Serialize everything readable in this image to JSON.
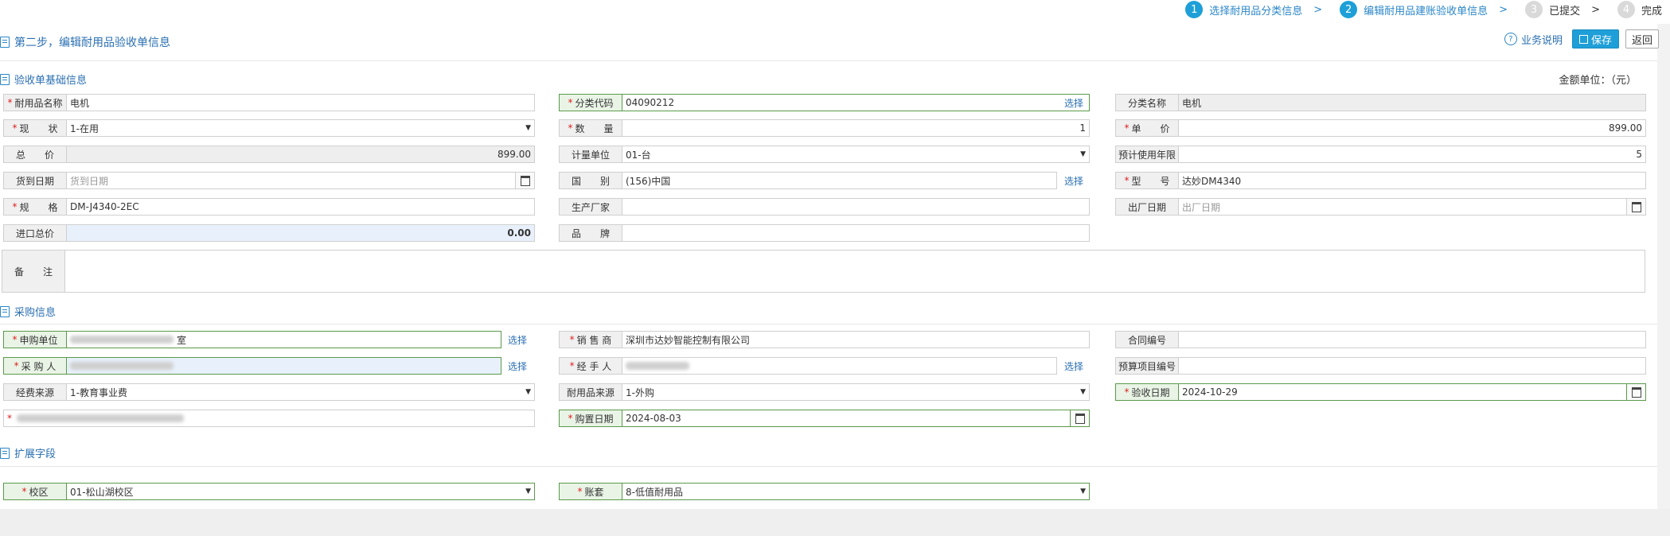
{
  "steps": [
    {
      "num": "1",
      "label": "选择耐用品分类信息",
      "active": true
    },
    {
      "num": "2",
      "label": "编辑耐用品建账验收单信息",
      "active": true
    },
    {
      "num": "3",
      "label": "已提交",
      "active": false
    },
    {
      "num": "4",
      "label": "完成",
      "active": false
    }
  ],
  "step_sep": ">",
  "page_title": "第二步，编辑耐用品验收单信息",
  "actions": {
    "help": "业务说明",
    "save": "保存",
    "back": "返回"
  },
  "sections": {
    "basic": "验收单基础信息",
    "purchase": "采购信息",
    "ext": "扩展字段"
  },
  "amount_unit": "金额单位：（元）",
  "choose_label": "选择",
  "fields": {
    "name": {
      "label": "耐用品名称",
      "value": "电机"
    },
    "code": {
      "label": "分类代码",
      "value": "04090212"
    },
    "cat_name": {
      "label": "分类名称",
      "value": "电机"
    },
    "status": {
      "label": "现　　状",
      "value": "1-在用"
    },
    "qty": {
      "label": "数　　量",
      "value": "1"
    },
    "price": {
      "label": "单　　价",
      "value": "899.00"
    },
    "total": {
      "label": "总　　价",
      "value": "899.00"
    },
    "unit": {
      "label": "计量单位",
      "value": "01-台"
    },
    "years": {
      "label": "预计使用年限",
      "value": "5"
    },
    "arrive": {
      "label": "货到日期",
      "placeholder": "货到日期"
    },
    "country": {
      "label": "国　　别",
      "value": "(156)中国"
    },
    "model": {
      "label": "型　　号",
      "value": "达妙DM4340"
    },
    "spec": {
      "label": "规　　格",
      "value": "DM-J4340-2EC"
    },
    "maker": {
      "label": "生产厂家",
      "value": ""
    },
    "factory_date": {
      "label": "出厂日期",
      "placeholder": "出厂日期"
    },
    "import_total": {
      "label": "进口总价",
      "value": "0.00"
    },
    "brand": {
      "label": "品　　牌",
      "value": ""
    },
    "remark": {
      "label": "备　　注",
      "value": ""
    },
    "dept": {
      "label": "申购单位",
      "value": "室"
    },
    "seller": {
      "label": "销 售 商",
      "value": "深圳市达妙智能控制有限公司"
    },
    "contract": {
      "label": "合同编号",
      "value": ""
    },
    "buyer": {
      "label": "采 购 人",
      "value": ""
    },
    "handler": {
      "label": "经 手 人",
      "value": ""
    },
    "budget": {
      "label": "预算项目编号",
      "value": ""
    },
    "fund": {
      "label": "经费来源",
      "value": "1-教育事业费"
    },
    "source": {
      "label": "耐用品来源",
      "value": "1-外购"
    },
    "accept_date": {
      "label": "验收日期",
      "value": "2024-10-29"
    },
    "hidden": {
      "label": "",
      "value": ""
    },
    "buy_date": {
      "label": "购置日期",
      "value": "2024-08-03"
    },
    "campus": {
      "label": "校区",
      "value": "01-松山湖校区"
    },
    "ledger": {
      "label": "账套",
      "value": "8-低值耐用品"
    }
  }
}
